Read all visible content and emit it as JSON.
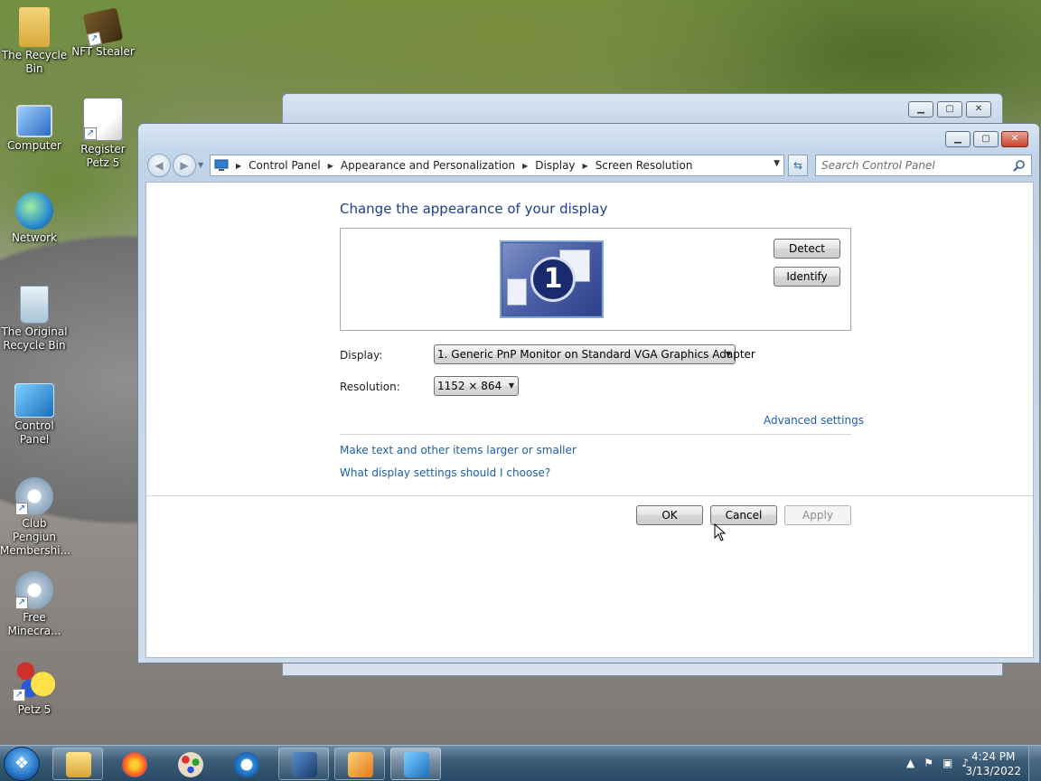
{
  "desktop_icons": [
    {
      "label": "The Recycle Bin",
      "icon": "folder-icon"
    },
    {
      "label": "NFT Stealer",
      "icon": "box-icon"
    },
    {
      "label": "Computer",
      "icon": "computer-icon"
    },
    {
      "label": "Register Petz 5",
      "icon": "pen-paper-icon"
    },
    {
      "label": "Network",
      "icon": "network-globe-icon"
    },
    {
      "label": "The Original Recycle Bin",
      "icon": "recycle-bin-icon"
    },
    {
      "label": "Control Panel",
      "icon": "control-panel-icon"
    },
    {
      "label": "Club Pengiun Membershi...",
      "icon": "gear-icon"
    },
    {
      "label": "Free Minecra...",
      "icon": "gear-icon"
    },
    {
      "label": "Petz 5",
      "icon": "petz-logo-icon"
    }
  ],
  "address_bar": {
    "crumbs": [
      "Control Panel",
      "Appearance and Personalization",
      "Display",
      "Screen Resolution"
    ]
  },
  "search": {
    "placeholder": "Search Control Panel"
  },
  "page": {
    "heading": "Change the appearance of your display",
    "monitor_number": "1",
    "detect_label": "Detect",
    "identify_label": "Identify",
    "display_label": "Display:",
    "display_value": "1. Generic PnP Monitor on Standard VGA Graphics Adapter",
    "resolution_label": "Resolution:",
    "resolution_value": "1152 × 864",
    "advanced_link": "Advanced settings",
    "link_text_size": "Make text and other items larger or smaller",
    "link_display_help": "What display settings should I choose?",
    "ok_label": "OK",
    "cancel_label": "Cancel",
    "apply_label": "Apply"
  },
  "taskbar": {
    "items": [
      "explorer-folder-icon",
      "firefox-icon",
      "paint-icon",
      "internet-explorer-icon",
      "computer-management-icon",
      "media-player-icon",
      "control-panel-icon"
    ],
    "time": "4:24 PM",
    "date": "3/13/2022"
  },
  "colors": {
    "accent": "#1e3e8f",
    "link": "#1d5fa8"
  }
}
